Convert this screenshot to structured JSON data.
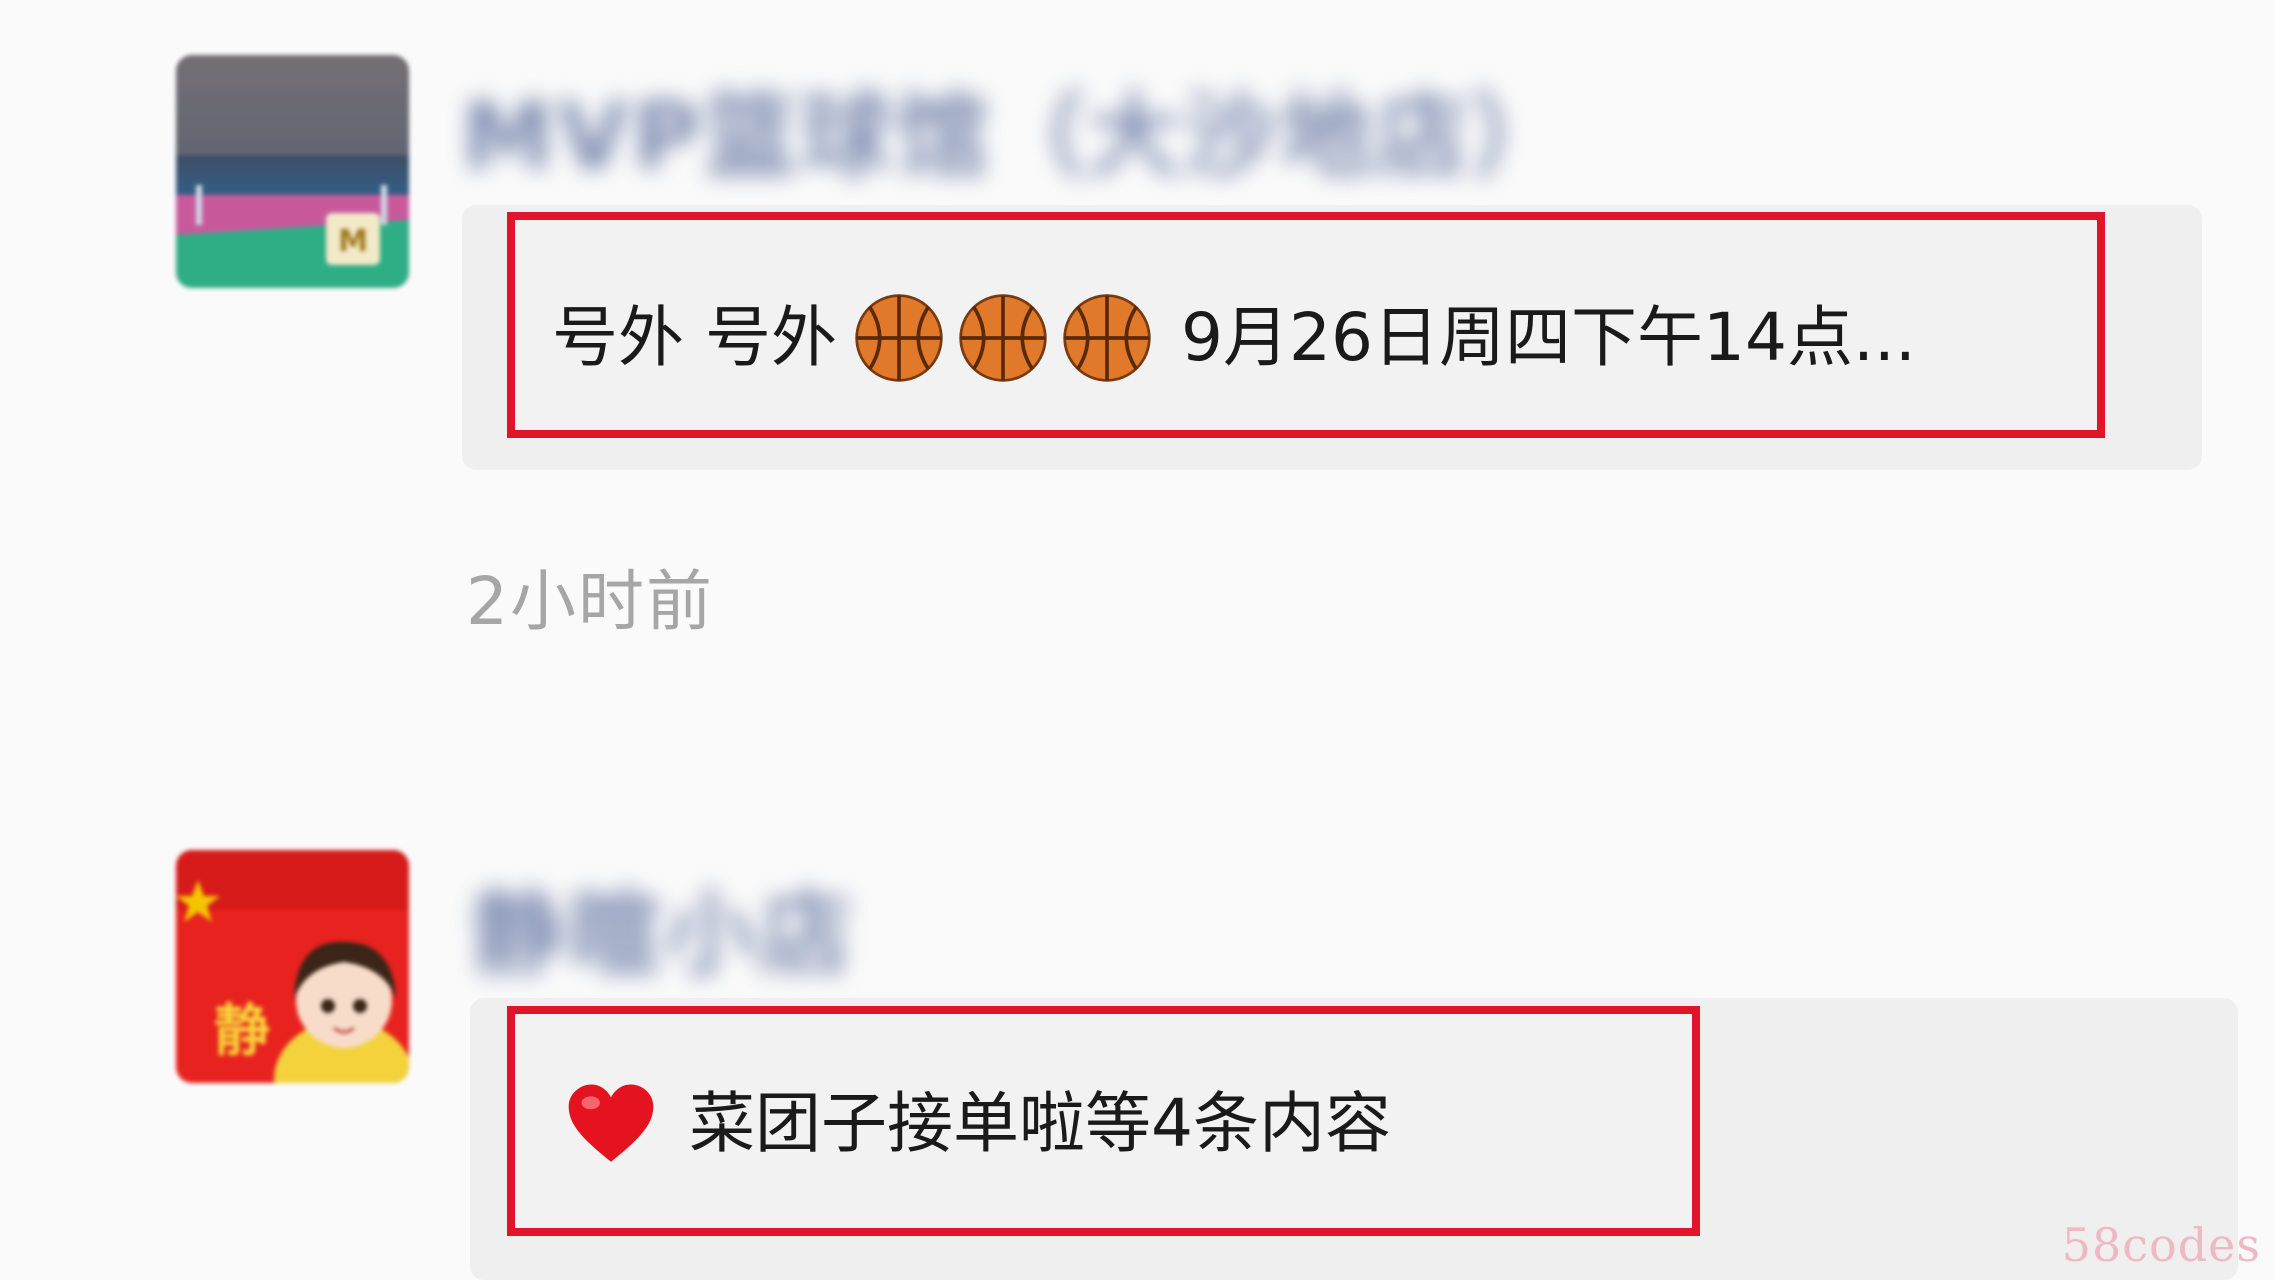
{
  "posts": [
    {
      "author_name": "MVP篮球馆（大沙地店）",
      "preview_prefix": "号外 号外",
      "preview_suffix": "9月26日周四下午14点...",
      "emoji": [
        "basketball-icon",
        "basketball-icon",
        "basketball-icon"
      ],
      "timestamp": "2小时前"
    },
    {
      "author_name": "静暄小店",
      "preview_text": "菜团子接单啦等4条内容",
      "emoji": [
        "heart-icon"
      ]
    }
  ],
  "watermark": "58codes",
  "colors": {
    "highlight": "#e2142b",
    "card_bg": "#efefef",
    "page_bg": "#fafafa",
    "timestamp": "#a6a6a6",
    "author_name": "#7b8ab0"
  }
}
